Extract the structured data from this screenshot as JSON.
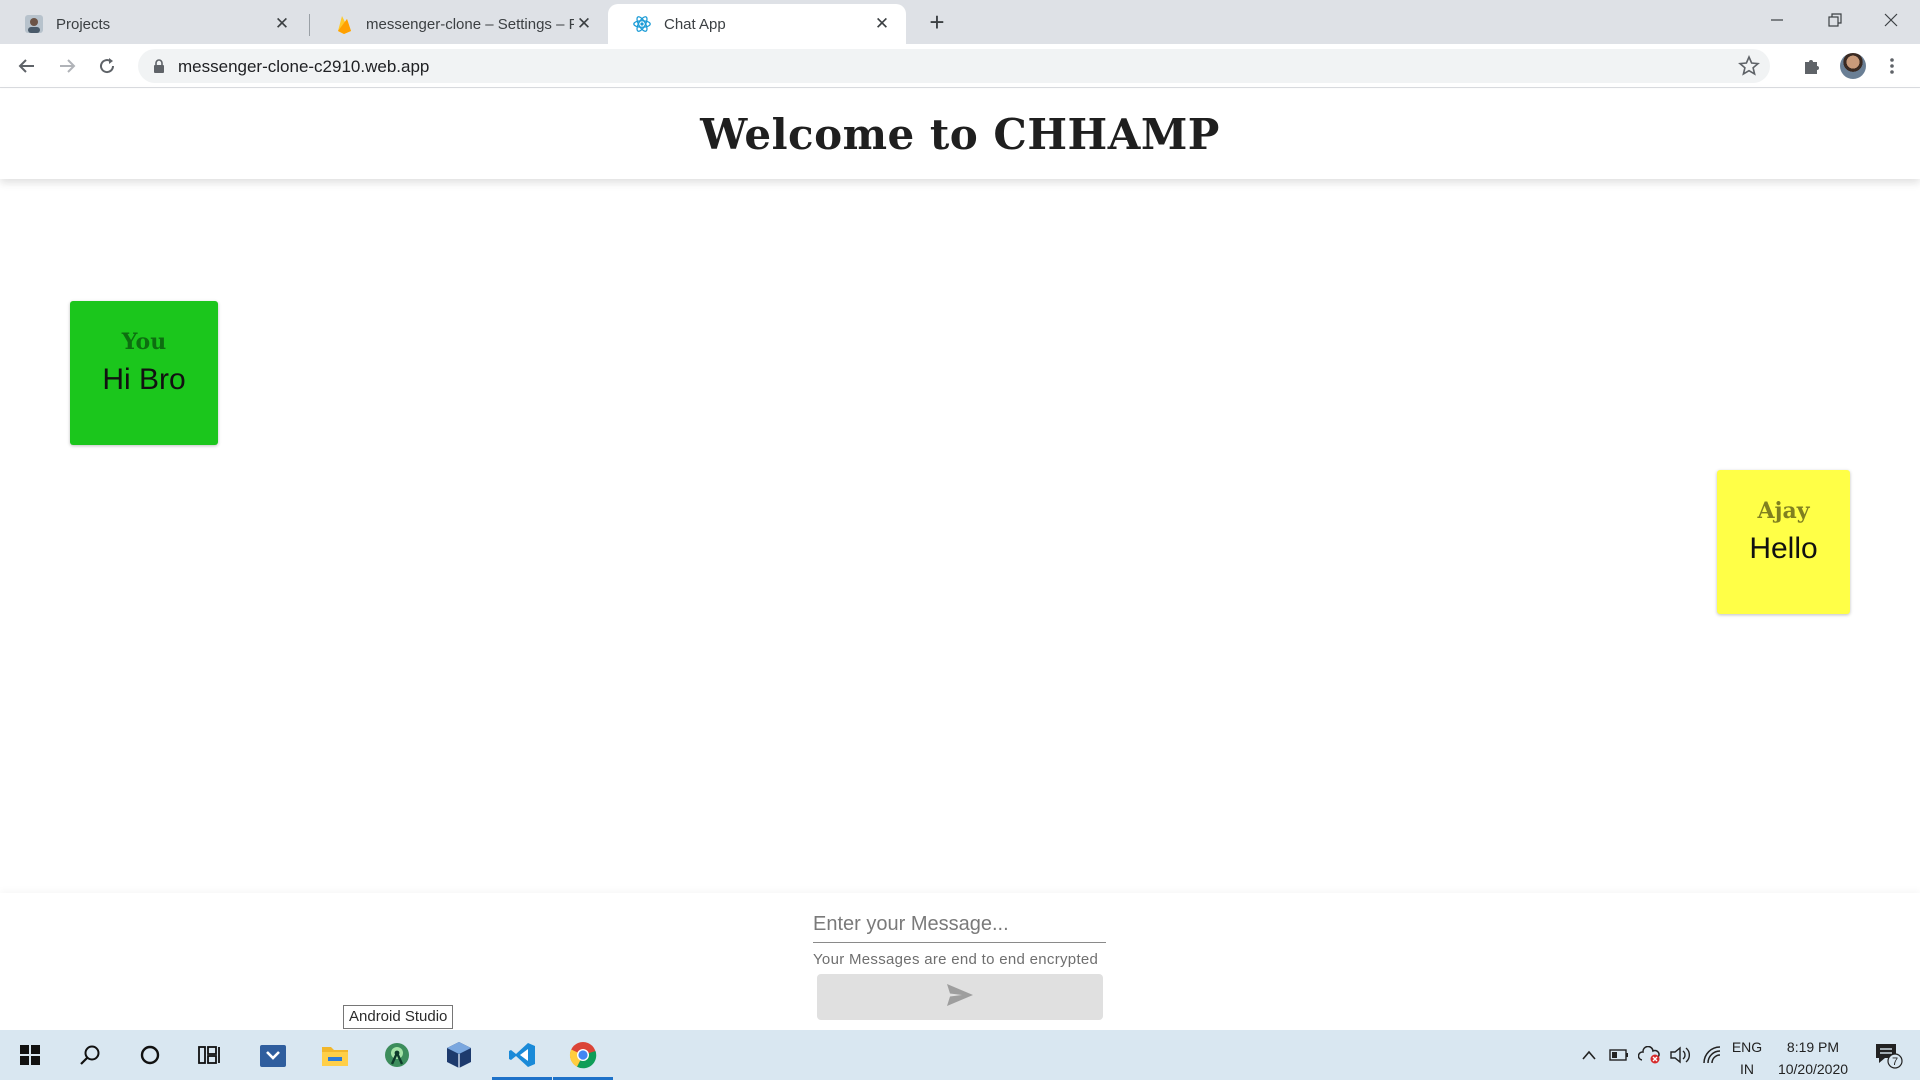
{
  "browser": {
    "tabs": [
      {
        "title": "Projects",
        "favicon": "github-avatar-icon",
        "active": false
      },
      {
        "title": "messenger-clone – Settings – Fir",
        "favicon": "firebase-icon",
        "active": false
      },
      {
        "title": "Chat App",
        "favicon": "react-icon",
        "active": true
      }
    ],
    "url": "messenger-clone-c2910.web.app"
  },
  "app": {
    "title": "Welcome to CHHAMP",
    "messages": [
      {
        "sender": "You",
        "text": "Hi Bro",
        "color": "#1bc61c"
      },
      {
        "sender": "Ajay",
        "text": "Hello",
        "color": "#ffff47"
      }
    ],
    "composer": {
      "placeholder": "Enter your Message...",
      "helper": "Your Messages are end to end encrypted"
    }
  },
  "tooltip": "Android Studio",
  "taskbar": {
    "items": [
      "start-icon",
      "search-icon",
      "cortana-icon",
      "task-view-icon",
      "store-icon",
      "file-explorer-icon",
      "android-studio-icon",
      "virtualbox-icon",
      "vscode-icon",
      "chrome-icon"
    ],
    "language": "ENG",
    "region": "IN",
    "time": "8:19 PM",
    "date": "10/20/2020",
    "notifications": "7"
  }
}
